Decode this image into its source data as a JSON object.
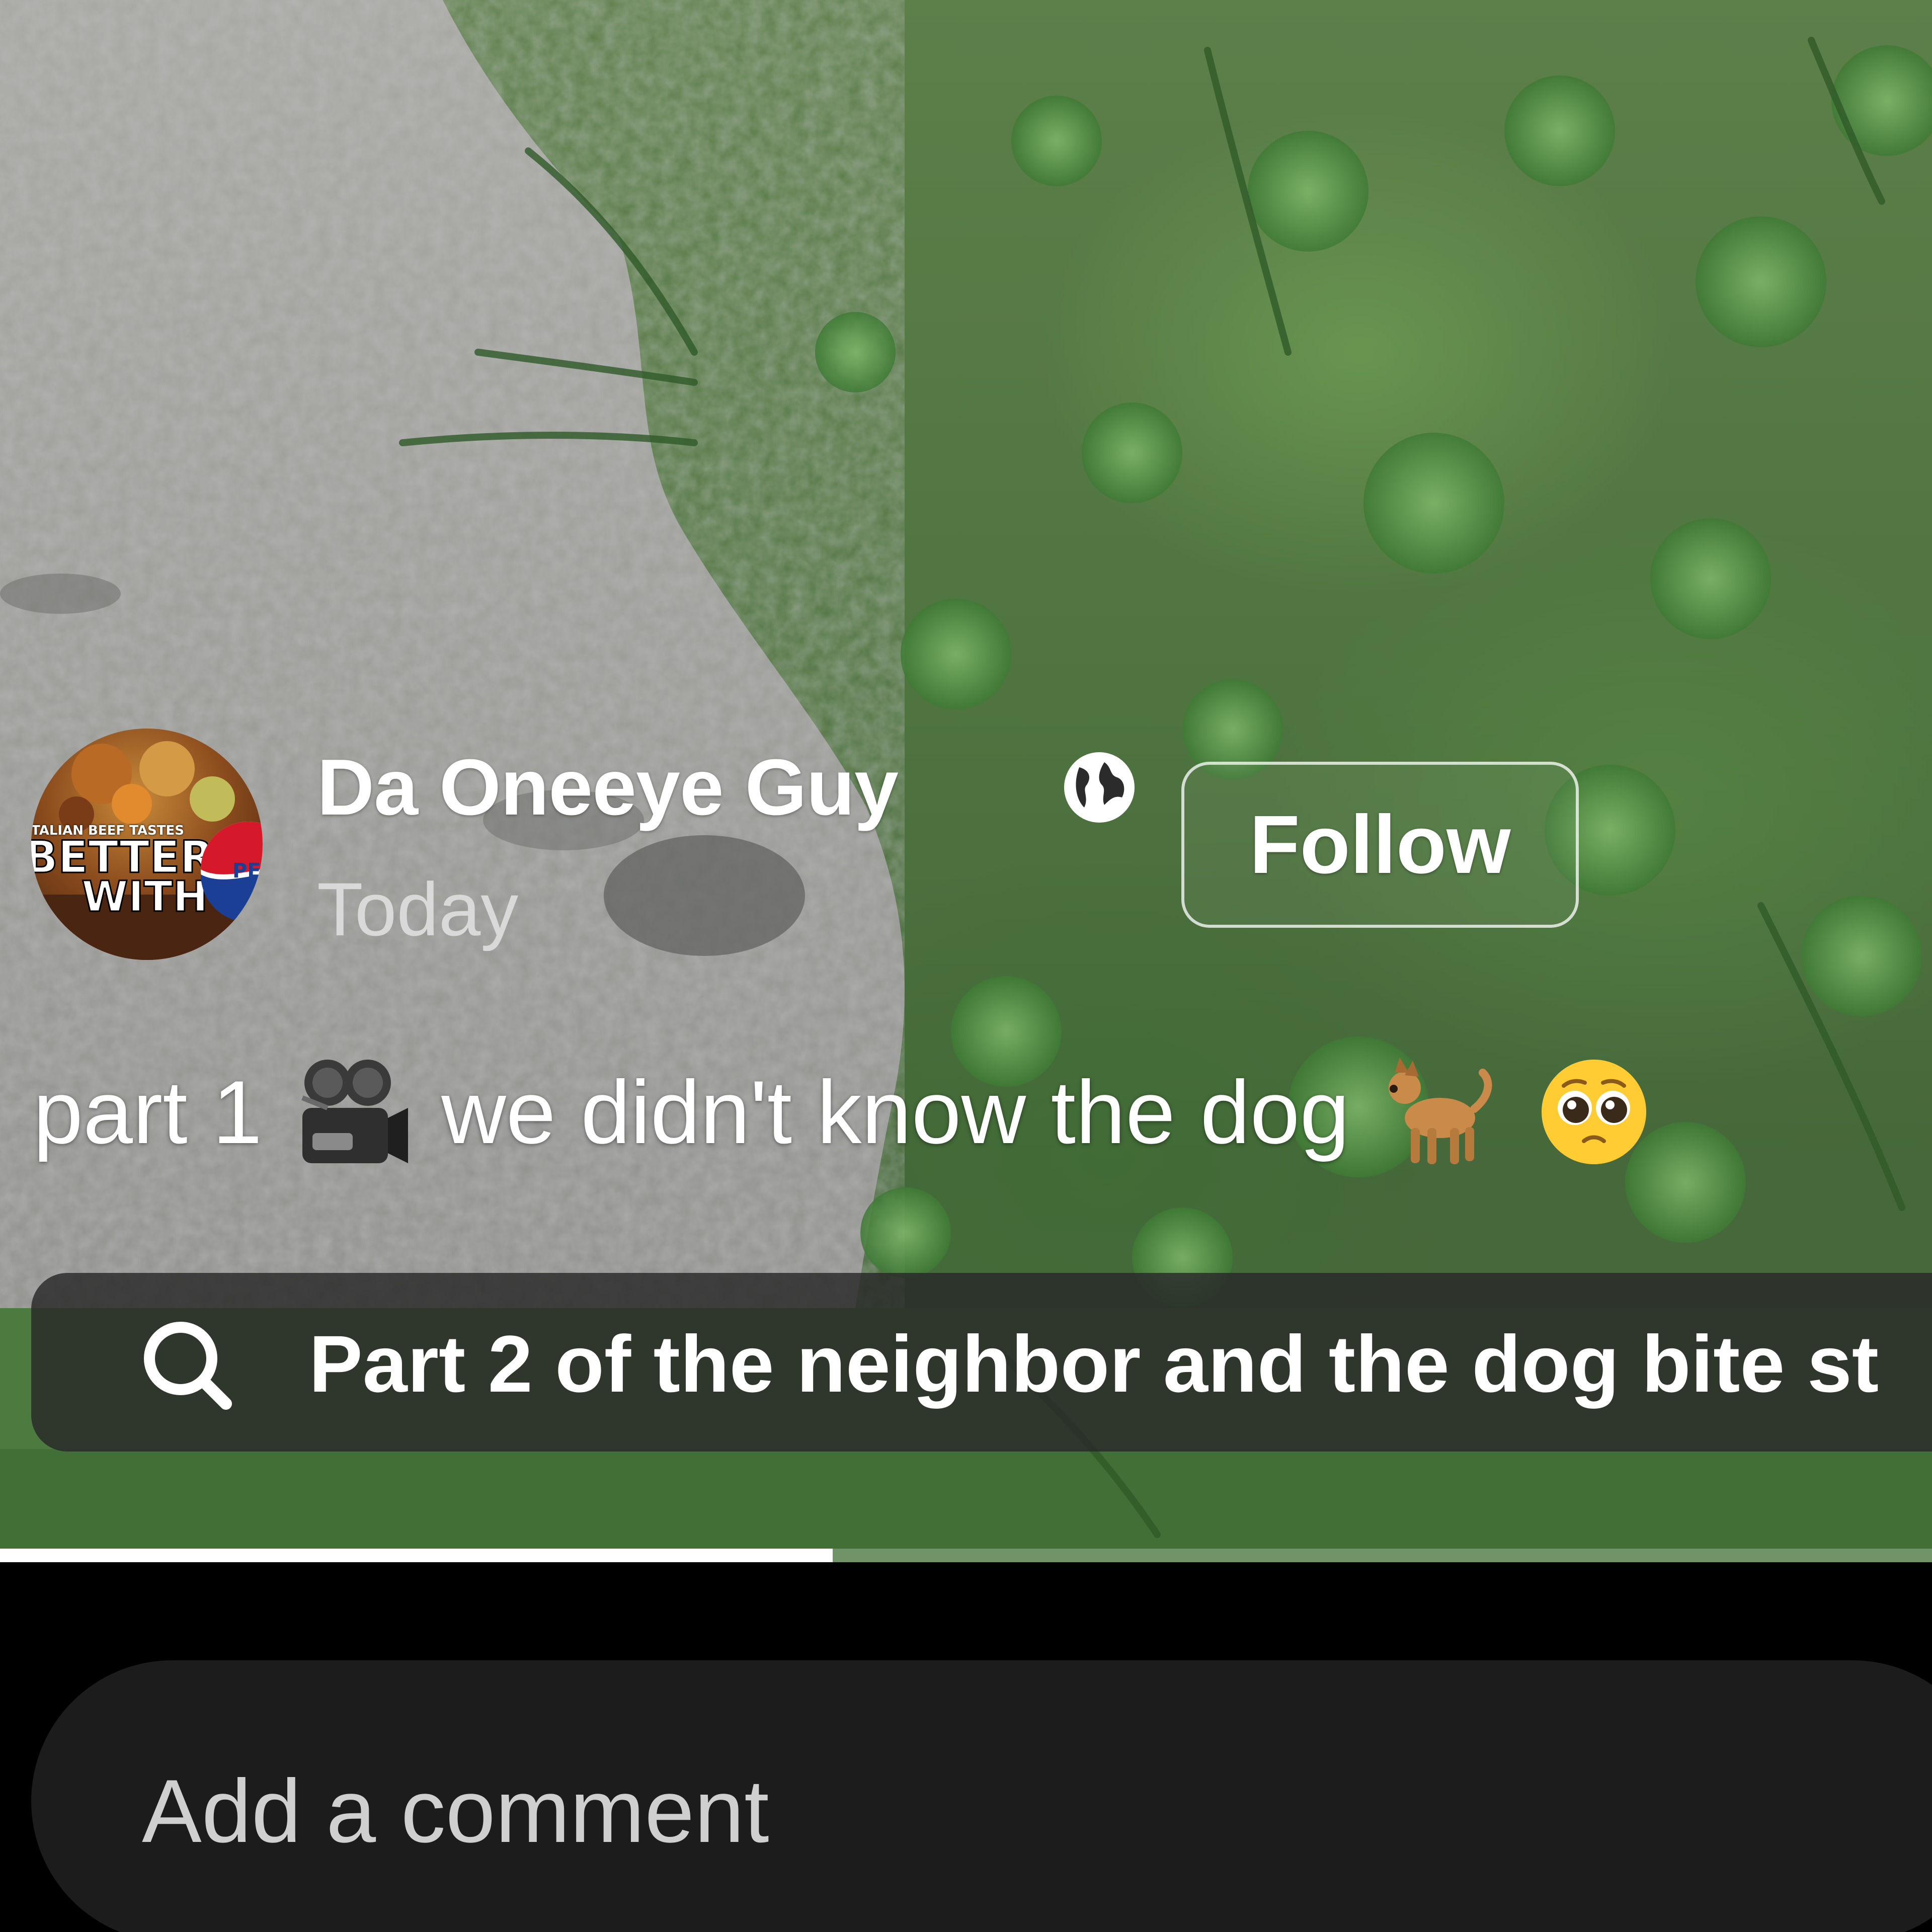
{
  "post": {
    "author_name": "Da Oneeye Guy",
    "audience_icon": "globe-icon",
    "timestamp": "Today",
    "follow_label": "Follow",
    "avatar": {
      "icon": "avatar-logo",
      "brand_line_small": "TALIAN BEEF TASTES",
      "brand_line_big": "BETTER",
      "brand_line_big2": "WITH",
      "brand_mark": "PEP"
    },
    "caption": {
      "part1": "part 1",
      "emoji1": "movie-camera-emoji",
      "text": "we didn't know the dog",
      "emoji2": "dog-emoji",
      "emoji3": "pleading-face-emoji"
    }
  },
  "search_suggestion": {
    "icon": "search-icon",
    "text": "Part 2 of the neighbor and the dog bite st"
  },
  "progress": {
    "fraction": 0.431
  },
  "comment": {
    "placeholder": "Add a comment"
  },
  "colors": {
    "background": "#000000",
    "comment_field": "#1c1c1c",
    "search_pill": "rgba(40,40,40,0.82)",
    "text_primary": "#ffffff",
    "text_secondary": "#d9d9d9"
  }
}
